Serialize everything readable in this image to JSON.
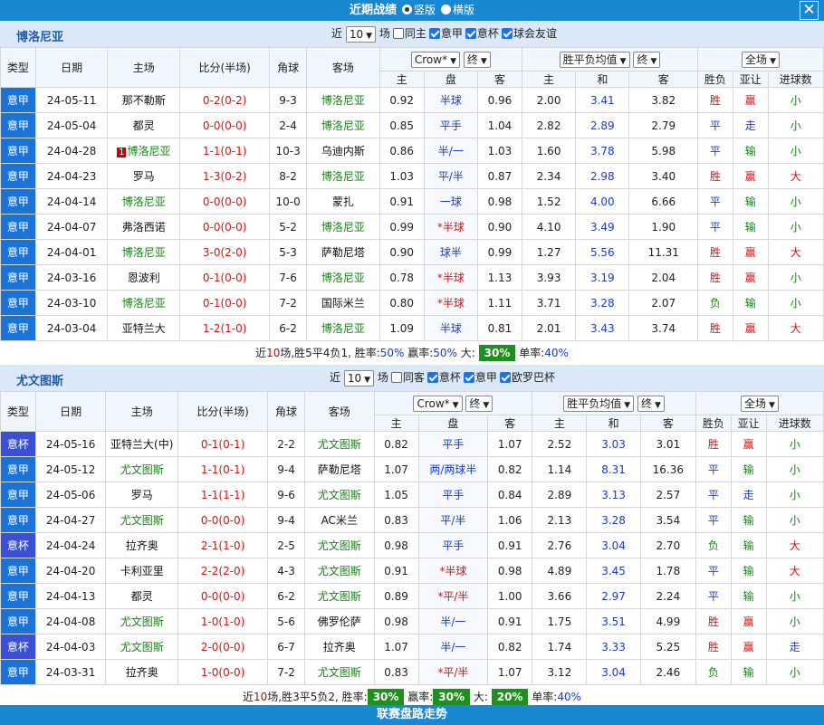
{
  "header": {
    "title": "近期战绩",
    "opt1": "竖版",
    "opt2": "横版"
  },
  "footer": "联赛盘路走势",
  "teams": [
    {
      "name": "博洛尼亚",
      "filter": {
        "near": "近",
        "count": "10",
        "unit": "场",
        "opts": [
          {
            "label": "同主",
            "on": false
          },
          {
            "label": "意甲",
            "on": true
          },
          {
            "label": "意杯",
            "on": true
          },
          {
            "label": "球会友谊",
            "on": true
          }
        ]
      },
      "sel": {
        "company": "Crow*",
        "end1": "终",
        "avg": "胜平负均值",
        "end2": "终",
        "scope": "全场"
      },
      "cols": {
        "type": "类型",
        "date": "日期",
        "home": "主场",
        "score": "比分(半场)",
        "corner": "角球",
        "away": "客场",
        "zhu": "主",
        "pan": "盘",
        "ke": "客",
        "zhu2": "主",
        "he": "和",
        "ke2": "客",
        "wl": "胜负",
        "yr": "亚让",
        "jq": "进球数"
      },
      "rows": [
        {
          "lg": "意甲",
          "date": "24-05-11",
          "home": "那不勒斯",
          "hc": "blk",
          "hbadge": "",
          "score": "0-2(0-2)",
          "sc": "r",
          "corner": "9-3",
          "away": "博洛尼亚",
          "ac": "g",
          "o1": "0.92",
          "pan": "半球",
          "pc": "b",
          "o2": "0.96",
          "e1": "2.00",
          "e2": "3.41",
          "e3": "3.82",
          "wl": "胜",
          "wlc": "r",
          "yr": "赢",
          "yrc": "r",
          "jq": "小",
          "jqc": "g"
        },
        {
          "lg": "意甲",
          "date": "24-05-04",
          "home": "都灵",
          "hc": "blk",
          "hbadge": "",
          "score": "0-0(0-0)",
          "sc": "r",
          "corner": "2-4",
          "away": "博洛尼亚",
          "ac": "g",
          "o1": "0.85",
          "pan": "平手",
          "pc": "b",
          "o2": "1.04",
          "e1": "2.82",
          "e2": "2.89",
          "e3": "2.79",
          "wl": "平",
          "wlc": "b",
          "yr": "走",
          "yrc": "b",
          "jq": "小",
          "jqc": "g"
        },
        {
          "lg": "意甲",
          "date": "24-04-28",
          "home": "博洛尼亚",
          "hc": "g",
          "hbadge": "1",
          "score": "1-1(0-1)",
          "sc": "r",
          "corner": "10-3",
          "away": "乌迪内斯",
          "ac": "blk",
          "o1": "0.86",
          "pan": "半/一",
          "pc": "b",
          "o2": "1.03",
          "e1": "1.60",
          "e2": "3.78",
          "e3": "5.98",
          "wl": "平",
          "wlc": "b",
          "yr": "输",
          "yrc": "g",
          "jq": "小",
          "jqc": "g"
        },
        {
          "lg": "意甲",
          "date": "24-04-23",
          "home": "罗马",
          "hc": "blk",
          "hbadge": "",
          "score": "1-3(0-2)",
          "sc": "r",
          "corner": "8-2",
          "away": "博洛尼亚",
          "ac": "g",
          "o1": "1.03",
          "pan": "平/半",
          "pc": "b",
          "o2": "0.87",
          "e1": "2.34",
          "e2": "2.98",
          "e3": "3.40",
          "wl": "胜",
          "wlc": "r",
          "yr": "赢",
          "yrc": "r",
          "jq": "大",
          "jqc": "r"
        },
        {
          "lg": "意甲",
          "date": "24-04-14",
          "home": "博洛尼亚",
          "hc": "g",
          "hbadge": "",
          "score": "0-0(0-0)",
          "sc": "r",
          "corner": "10-0",
          "away": "蒙扎",
          "ac": "blk",
          "o1": "0.91",
          "pan": "一球",
          "pc": "b",
          "o2": "0.98",
          "e1": "1.52",
          "e2": "4.00",
          "e3": "6.66",
          "wl": "平",
          "wlc": "b",
          "yr": "输",
          "yrc": "g",
          "jq": "小",
          "jqc": "g"
        },
        {
          "lg": "意甲",
          "date": "24-04-07",
          "home": "弗洛西诺",
          "hc": "blk",
          "hbadge": "",
          "score": "0-0(0-0)",
          "sc": "r",
          "corner": "5-2",
          "away": "博洛尼亚",
          "ac": "g",
          "o1": "0.99",
          "pan": "*半球",
          "pc": "r",
          "o2": "0.90",
          "e1": "4.10",
          "e2": "3.49",
          "e3": "1.90",
          "wl": "平",
          "wlc": "b",
          "yr": "输",
          "yrc": "g",
          "jq": "小",
          "jqc": "g"
        },
        {
          "lg": "意甲",
          "date": "24-04-01",
          "home": "博洛尼亚",
          "hc": "g",
          "hbadge": "",
          "score": "3-0(2-0)",
          "sc": "r",
          "corner": "5-3",
          "away": "萨勒尼塔",
          "ac": "blk",
          "o1": "0.90",
          "pan": "球半",
          "pc": "b",
          "o2": "0.99",
          "e1": "1.27",
          "e2": "5.56",
          "e3": "11.31",
          "wl": "胜",
          "wlc": "r",
          "yr": "赢",
          "yrc": "r",
          "jq": "大",
          "jqc": "r"
        },
        {
          "lg": "意甲",
          "date": "24-03-16",
          "home": "恩波利",
          "hc": "blk",
          "hbadge": "",
          "score": "0-1(0-0)",
          "sc": "r",
          "corner": "7-6",
          "away": "博洛尼亚",
          "ac": "g",
          "o1": "0.78",
          "pan": "*半球",
          "pc": "r",
          "o2": "1.13",
          "e1": "3.93",
          "e2": "3.19",
          "e3": "2.04",
          "wl": "胜",
          "wlc": "r",
          "yr": "赢",
          "yrc": "r",
          "jq": "小",
          "jqc": "g"
        },
        {
          "lg": "意甲",
          "date": "24-03-10",
          "home": "博洛尼亚",
          "hc": "g",
          "hbadge": "",
          "score": "0-1(0-0)",
          "sc": "r",
          "corner": "7-2",
          "away": "国际米兰",
          "ac": "blk",
          "o1": "0.80",
          "pan": "*半球",
          "pc": "r",
          "o2": "1.11",
          "e1": "3.71",
          "e2": "3.28",
          "e3": "2.07",
          "wl": "负",
          "wlc": "g",
          "yr": "输",
          "yrc": "g",
          "jq": "小",
          "jqc": "g"
        },
        {
          "lg": "意甲",
          "date": "24-03-04",
          "home": "亚特兰大",
          "hc": "blk",
          "hbadge": "",
          "score": "1-2(1-0)",
          "sc": "r",
          "corner": "6-2",
          "away": "博洛尼亚",
          "ac": "g",
          "o1": "1.09",
          "pan": "半球",
          "pc": "b",
          "o2": "0.81",
          "e1": "2.01",
          "e2": "3.43",
          "e3": "3.74",
          "wl": "胜",
          "wlc": "r",
          "yr": "赢",
          "yrc": "r",
          "jq": "大",
          "jqc": "r"
        }
      ],
      "summary": {
        "a": "近",
        "n": "10",
        "b": "场,胜5平4负1, 胜率:",
        "win": "50%",
        "c": " 赢率:",
        "ying": "50%",
        "d": " 大:",
        "da": "30%",
        "e": " 单率:",
        "dan": "40%"
      }
    },
    {
      "name": "尤文图斯",
      "filter": {
        "near": "近",
        "count": "10",
        "unit": "场",
        "opts": [
          {
            "label": "同客",
            "on": false
          },
          {
            "label": "意杯",
            "on": true
          },
          {
            "label": "意甲",
            "on": true
          },
          {
            "label": "欧罗巴杯",
            "on": true
          }
        ]
      },
      "sel": {
        "company": "Crow*",
        "end1": "终",
        "avg": "胜平负均值",
        "end2": "终",
        "scope": "全场"
      },
      "cols": {
        "type": "类型",
        "date": "日期",
        "home": "主场",
        "score": "比分(半场)",
        "corner": "角球",
        "away": "客场",
        "zhu": "主",
        "pan": "盘",
        "ke": "客",
        "zhu2": "主",
        "he": "和",
        "ke2": "客",
        "wl": "胜负",
        "yr": "亚让",
        "jq": "进球数"
      },
      "rows": [
        {
          "lg": "意杯",
          "date": "24-05-16",
          "home": "亚特兰大(中)",
          "hc": "blk",
          "hbadge": "",
          "score": "0-1(0-1)",
          "sc": "r",
          "corner": "2-2",
          "away": "尤文图斯",
          "ac": "g",
          "o1": "0.82",
          "pan": "平手",
          "pc": "b",
          "o2": "1.07",
          "e1": "2.52",
          "e2": "3.03",
          "e3": "3.01",
          "wl": "胜",
          "wlc": "r",
          "yr": "赢",
          "yrc": "r",
          "jq": "小",
          "jqc": "g"
        },
        {
          "lg": "意甲",
          "date": "24-05-12",
          "home": "尤文图斯",
          "hc": "g",
          "hbadge": "",
          "score": "1-1(0-1)",
          "sc": "r",
          "corner": "9-4",
          "away": "萨勒尼塔",
          "ac": "blk",
          "o1": "1.07",
          "pan": "两/两球半",
          "pc": "b",
          "o2": "0.82",
          "e1": "1.14",
          "e2": "8.31",
          "e3": "16.36",
          "wl": "平",
          "wlc": "b",
          "yr": "输",
          "yrc": "g",
          "jq": "小",
          "jqc": "g"
        },
        {
          "lg": "意甲",
          "date": "24-05-06",
          "home": "罗马",
          "hc": "blk",
          "hbadge": "",
          "score": "1-1(1-1)",
          "sc": "r",
          "corner": "9-6",
          "away": "尤文图斯",
          "ac": "g",
          "o1": "1.05",
          "pan": "平手",
          "pc": "b",
          "o2": "0.84",
          "e1": "2.89",
          "e2": "3.13",
          "e3": "2.57",
          "wl": "平",
          "wlc": "b",
          "yr": "走",
          "yrc": "b",
          "jq": "小",
          "jqc": "g"
        },
        {
          "lg": "意甲",
          "date": "24-04-27",
          "home": "尤文图斯",
          "hc": "g",
          "hbadge": "",
          "score": "0-0(0-0)",
          "sc": "r",
          "corner": "9-4",
          "away": "AC米兰",
          "ac": "blk",
          "o1": "0.83",
          "pan": "平/半",
          "pc": "b",
          "o2": "1.06",
          "e1": "2.13",
          "e2": "3.28",
          "e3": "3.54",
          "wl": "平",
          "wlc": "b",
          "yr": "输",
          "yrc": "g",
          "jq": "小",
          "jqc": "g"
        },
        {
          "lg": "意杯",
          "date": "24-04-24",
          "home": "拉齐奥",
          "hc": "blk",
          "hbadge": "",
          "score": "2-1(1-0)",
          "sc": "r",
          "corner": "2-5",
          "away": "尤文图斯",
          "ac": "g",
          "o1": "0.98",
          "pan": "平手",
          "pc": "b",
          "o2": "0.91",
          "e1": "2.76",
          "e2": "3.04",
          "e3": "2.70",
          "wl": "负",
          "wlc": "g",
          "yr": "输",
          "yrc": "g",
          "jq": "大",
          "jqc": "r"
        },
        {
          "lg": "意甲",
          "date": "24-04-20",
          "home": "卡利亚里",
          "hc": "blk",
          "hbadge": "",
          "score": "2-2(2-0)",
          "sc": "r",
          "corner": "4-3",
          "away": "尤文图斯",
          "ac": "g",
          "o1": "0.91",
          "pan": "*半球",
          "pc": "r",
          "o2": "0.98",
          "e1": "4.89",
          "e2": "3.45",
          "e3": "1.78",
          "wl": "平",
          "wlc": "b",
          "yr": "输",
          "yrc": "g",
          "jq": "大",
          "jqc": "r"
        },
        {
          "lg": "意甲",
          "date": "24-04-13",
          "home": "都灵",
          "hc": "blk",
          "hbadge": "",
          "score": "0-0(0-0)",
          "sc": "r",
          "corner": "6-2",
          "away": "尤文图斯",
          "ac": "g",
          "o1": "0.89",
          "pan": "*平/半",
          "pc": "r",
          "o2": "1.00",
          "e1": "3.66",
          "e2": "2.97",
          "e3": "2.24",
          "wl": "平",
          "wlc": "b",
          "yr": "输",
          "yrc": "g",
          "jq": "小",
          "jqc": "g"
        },
        {
          "lg": "意甲",
          "date": "24-04-08",
          "home": "尤文图斯",
          "hc": "g",
          "hbadge": "",
          "score": "1-0(1-0)",
          "sc": "r",
          "corner": "5-6",
          "away": "佛罗伦萨",
          "ac": "blk",
          "o1": "0.98",
          "pan": "半/一",
          "pc": "b",
          "o2": "0.91",
          "e1": "1.75",
          "e2": "3.51",
          "e3": "4.99",
          "wl": "胜",
          "wlc": "r",
          "yr": "赢",
          "yrc": "r",
          "jq": "小",
          "jqc": "g"
        },
        {
          "lg": "意杯",
          "date": "24-04-03",
          "home": "尤文图斯",
          "hc": "g",
          "hbadge": "",
          "score": "2-0(0-0)",
          "sc": "r",
          "corner": "6-7",
          "away": "拉齐奥",
          "ac": "blk",
          "o1": "1.07",
          "pan": "半/一",
          "pc": "b",
          "o2": "0.82",
          "e1": "1.74",
          "e2": "3.33",
          "e3": "5.25",
          "wl": "胜",
          "wlc": "r",
          "yr": "赢",
          "yrc": "r",
          "jq": "走",
          "jqc": "b"
        },
        {
          "lg": "意甲",
          "date": "24-03-31",
          "home": "拉齐奥",
          "hc": "blk",
          "hbadge": "",
          "score": "1-0(0-0)",
          "sc": "r",
          "corner": "7-2",
          "away": "尤文图斯",
          "ac": "g",
          "o1": "0.83",
          "pan": "*平/半",
          "pc": "r",
          "o2": "1.07",
          "e1": "3.12",
          "e2": "3.04",
          "e3": "2.46",
          "wl": "负",
          "wlc": "g",
          "yr": "输",
          "yrc": "g",
          "jq": "小",
          "jqc": "g"
        }
      ],
      "summary": {
        "a": "近",
        "n": "10",
        "b": "场,胜3平5负2, 胜率:",
        "win": "30%",
        "c": " 赢率:",
        "ying": "30%",
        "d": " 大:",
        "da": "20%",
        "e": " 单率:",
        "dan": "40%"
      }
    }
  ]
}
